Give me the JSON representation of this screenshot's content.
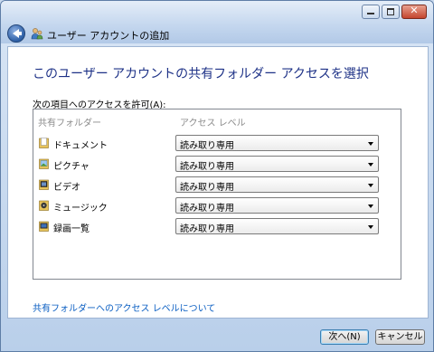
{
  "window": {
    "title": "ユーザー アカウントの追加",
    "controls": [
      "minimize-icon",
      "maximize-icon",
      "close-icon"
    ]
  },
  "heading": "このユーザー アカウントの共有フォルダー アクセスを選択",
  "allow_label": "次の項目へのアクセスを許可(A):",
  "list": {
    "columns": [
      "共有フォルダー",
      "アクセス レベル"
    ],
    "rows": [
      {
        "name": "ドキュメント",
        "access": "読み取り専用",
        "icon": "documents-folder-icon"
      },
      {
        "name": "ピクチャ",
        "access": "読み取り専用",
        "icon": "pictures-folder-icon"
      },
      {
        "name": "ビデオ",
        "access": "読み取り専用",
        "icon": "videos-folder-icon"
      },
      {
        "name": "ミュージック",
        "access": "読み取り専用",
        "icon": "music-folder-icon"
      },
      {
        "name": "録画一覧",
        "access": "読み取り専用",
        "icon": "recorded-tv-folder-icon"
      }
    ]
  },
  "help_link": "共有フォルダーへのアクセス レベルについて",
  "buttons": {
    "next": "次へ(N)",
    "cancel": "キャンセル"
  },
  "colors": {
    "heading": "#1e3287",
    "link": "#0a5ec2",
    "window_frame": "#b9cfea"
  }
}
